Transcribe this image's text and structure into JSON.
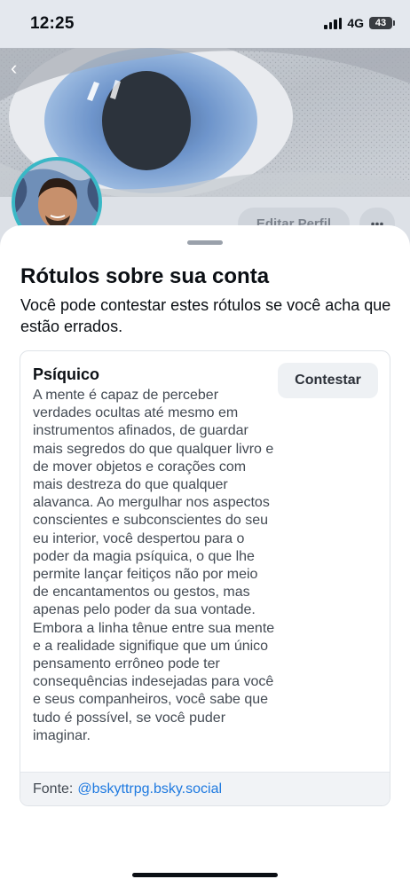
{
  "status_bar": {
    "time": "12:25",
    "network": "4G",
    "battery": "43"
  },
  "icons": {
    "back": "chevron-left-icon",
    "more": "ellipsis-icon",
    "signal": "cellular-signal-icon",
    "battery": "battery-icon"
  },
  "profile": {
    "edit_profile_label": "Editar Perfil"
  },
  "sheet": {
    "title": "Rótulos sobre sua conta",
    "subtitle": "Você pode contestar estes rótulos se você acha que estão errados.",
    "label": {
      "name": "Psíquico",
      "contest_label": "Contestar",
      "description": "A mente é capaz de perceber verdades ocultas até mesmo em instrumentos afinados, de guardar mais segredos do que qualquer livro e de mover objetos e corações com mais destreza do que qualquer alavanca. Ao mergulhar nos aspectos conscientes e subconscientes do seu eu interior, você despertou para o poder da magia psíquica, o que lhe permite lançar feitiços não por meio de encantamentos ou gestos, mas apenas pelo poder da sua vontade. Embora a linha tênue entre sua mente e a realidade signifique que um único pensamento errôneo pode ter consequências indesejadas para você e seus companheiros, você sabe que tudo é possível, se você puder imaginar.",
      "source_prefix": "Fonte:",
      "source_handle": "@bskyttrpg.bsky.social"
    }
  },
  "colors": {
    "accent_link": "#1f7ae0",
    "avatar_ring": "#39b8c6",
    "iris": "#5a86c4"
  }
}
